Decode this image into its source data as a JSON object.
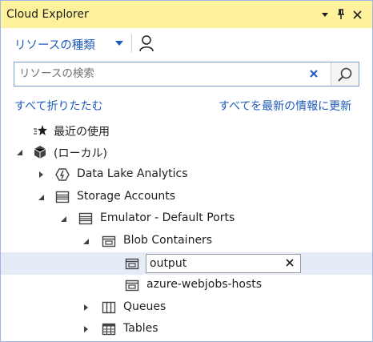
{
  "window": {
    "title": "Cloud Explorer",
    "buttons": [
      "dropdown-icon",
      "pin-icon",
      "close-icon"
    ]
  },
  "toolbar": {
    "resource_type_label": "リソースの種類",
    "account_icon": "person-icon"
  },
  "search": {
    "placeholder": "リソースの検索",
    "value": ""
  },
  "links": {
    "collapse_all": "すべて折りたたむ",
    "refresh_all": "すべてを最新の情報に更新"
  },
  "tree": {
    "recent": {
      "label": "最近の使用",
      "icon": "recent-star-icon"
    },
    "local": {
      "label": "(ローカル)",
      "icon": "cube-icon",
      "expanded": true
    },
    "data_lake": {
      "label": "Data Lake Analytics",
      "icon": "data-lake-icon",
      "expanded": false
    },
    "storage_accounts": {
      "label": "Storage Accounts",
      "icon": "storage-icon",
      "expanded": true
    },
    "emulator": {
      "label": "Emulator - Default Ports",
      "icon": "storage-icon",
      "expanded": true
    },
    "blob_containers": {
      "label": "Blob Containers",
      "icon": "container-icon",
      "expanded": true
    },
    "output": {
      "value": "output",
      "icon": "container-icon",
      "editing": true
    },
    "webjobs": {
      "label": "azure-webjobs-hosts",
      "icon": "container-icon"
    },
    "queues": {
      "label": "Queues",
      "icon": "queue-icon",
      "expanded": false
    },
    "tables": {
      "label": "Tables",
      "icon": "table-icon",
      "expanded": false
    }
  },
  "colors": {
    "title_bar": "#fff29d",
    "link": "#1e5bb8",
    "selection": "#e5ecf7",
    "border": "#9fb6e4"
  }
}
